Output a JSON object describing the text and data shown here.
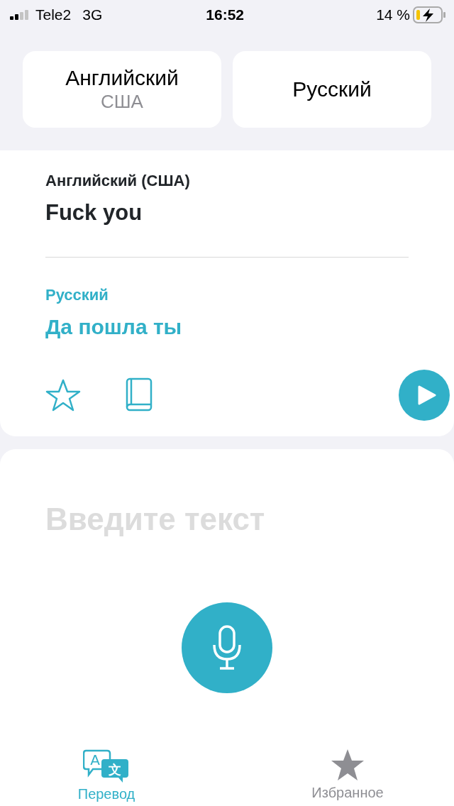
{
  "status_bar": {
    "carrier": "Tele2",
    "network": "3G",
    "time": "16:52",
    "battery": "14 %"
  },
  "languages": [
    {
      "name": "Английский",
      "region": "США"
    },
    {
      "name": "Русский"
    }
  ],
  "result": {
    "source_label": "Английский (США)",
    "source_text": "Fuck you",
    "target_label": "Русский",
    "target_text": "Да пошла ты"
  },
  "input": {
    "placeholder": "Введите текст"
  },
  "tabs": [
    {
      "label": "Перевод",
      "kind": "translate",
      "glyphs": [
        "A",
        "文"
      ],
      "selected": true
    },
    {
      "label": "Избранное",
      "kind": "favorites",
      "selected": false
    }
  ]
}
